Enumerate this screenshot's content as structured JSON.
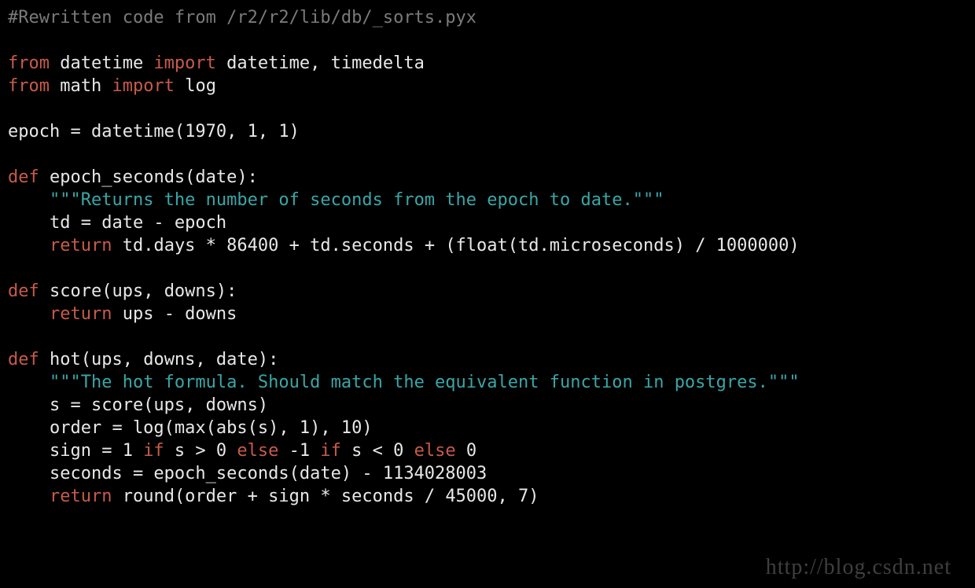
{
  "code": {
    "comment": "#Rewritten code from /r2/r2/lib/db/_sorts.pyx",
    "l1a": "from",
    "l1b": " datetime ",
    "l1c": "import",
    "l1d": " datetime, timedelta",
    "l2a": "from",
    "l2b": " math ",
    "l2c": "import",
    "l2d": " log",
    "l4": "epoch = datetime(1970, 1, 1)",
    "l6a": "def",
    "l6b": " epoch_seconds(date):",
    "l7a": "    ",
    "l7b": "\"\"\"Returns the number of seconds from the epoch to date.\"\"\"",
    "l8": "    td = date - epoch",
    "l9a": "    ",
    "l9b": "return",
    "l9c": " td.days * 86400 + td.seconds + (float(td.microseconds) / 1000000)",
    "l11a": "def",
    "l11b": " score(ups, downs):",
    "l12a": "    ",
    "l12b": "return",
    "l12c": " ups - downs",
    "l14a": "def",
    "l14b": " hot(ups, downs, date):",
    "l15a": "    ",
    "l15b": "\"\"\"The hot formula. Should match the equivalent function in postgres.\"\"\"",
    "l16": "    s = score(ups, downs)",
    "l17": "    order = log(max(abs(s), 1), 10)",
    "l18a": "    sign = 1 ",
    "l18b": "if",
    "l18c": " s > 0 ",
    "l18d": "else",
    "l18e": " -1 ",
    "l18f": "if",
    "l18g": " s < 0 ",
    "l18h": "else",
    "l18i": " 0",
    "l19": "    seconds = epoch_seconds(date) - 1134028003",
    "l20a": "    ",
    "l20b": "return",
    "l20c": " round(order + sign * seconds / 45000, 7)"
  },
  "watermark": "http://blog.csdn.net"
}
